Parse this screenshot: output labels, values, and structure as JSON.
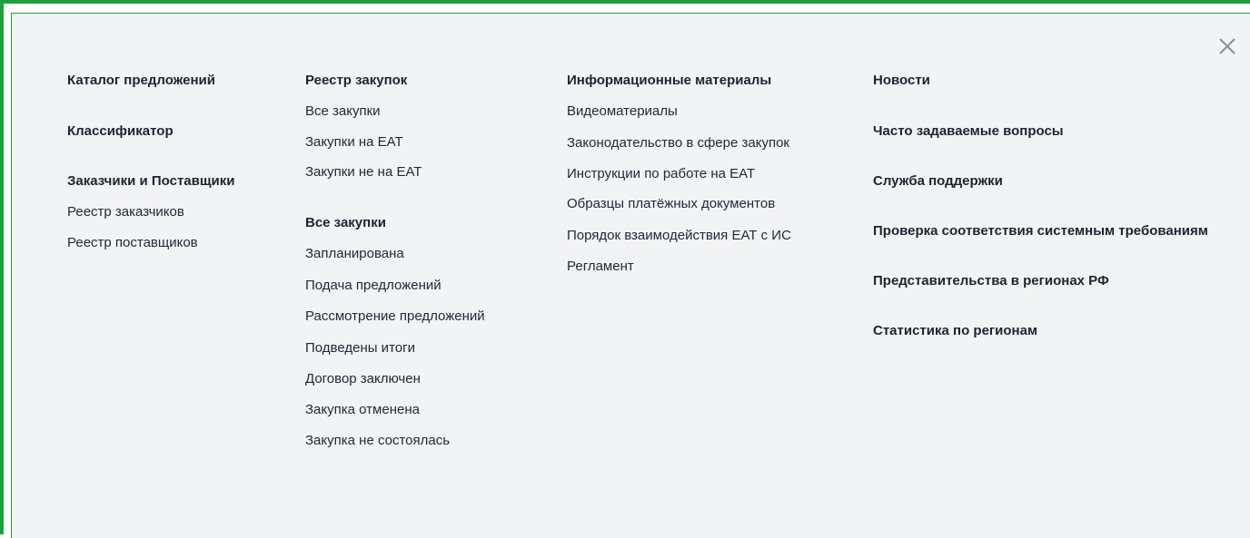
{
  "close": {
    "label": "Закрыть"
  },
  "col1": {
    "catalog": "Каталог предложений",
    "classifier": "Классификатор",
    "customers_suppliers": "Заказчики и Поставщики",
    "customers_registry": "Реестр заказчиков",
    "suppliers_registry": "Реестр поставщиков"
  },
  "col2": {
    "registry_head": "Реестр закупок",
    "all": "Все закупки",
    "on_eat": "Закупки на ЕАТ",
    "not_on_eat": "Закупки не на ЕАТ",
    "all_head": "Все закупки",
    "planned": "Запланирована",
    "submission": "Подача предложений",
    "review": "Рассмотрение предложений",
    "results": "Подведены итоги",
    "contract": "Договор заключен",
    "cancelled": "Закупка отменена",
    "failed": "Закупка не состоялась"
  },
  "col3": {
    "info_head": "Информационные материалы",
    "video": "Видеоматериалы",
    "law": "Законодательство в сфере закупок",
    "instructions": "Инструкции по работе на ЕАТ",
    "payment_samples": "Образцы платёжных документов",
    "interaction": "Порядок взаимодействия ЕАТ с ИС",
    "regulations": "Регламент"
  },
  "col4": {
    "news": "Новости",
    "faq": "Часто задаваемые вопросы",
    "support": "Служба поддержки",
    "sysreq": "Проверка соответствия системным требованиям",
    "regions": "Представительства в регионах РФ",
    "stats": "Статистика по регионам"
  }
}
